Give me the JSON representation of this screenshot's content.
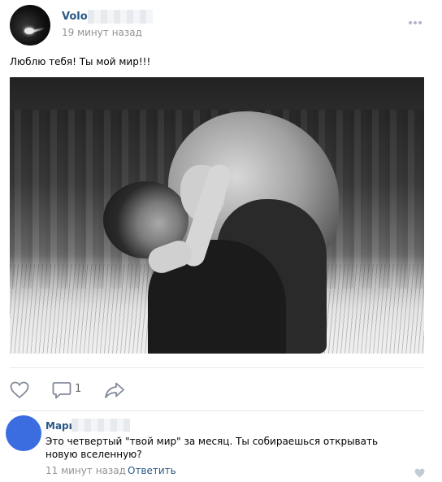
{
  "post": {
    "author": "Volod",
    "time": "19 минут назад",
    "text": "Люблю тебя! Ты мой мир!!!"
  },
  "actions": {
    "like_icon": "heart-icon",
    "comment_icon": "comment-icon",
    "comment_count": "1",
    "share_icon": "share-icon"
  },
  "comment": {
    "author": "Марин",
    "text": "Это четвертый \"твой мир\" за месяц. Ты собираешься открывать новую вселенную?",
    "time": "11 минут назад",
    "reply_label": "Ответить",
    "like_icon": "heart-icon"
  },
  "colors": {
    "link": "#2a5885",
    "muted": "#939393",
    "icon": "#828a99",
    "comment_avatar": "#3b6de0"
  }
}
